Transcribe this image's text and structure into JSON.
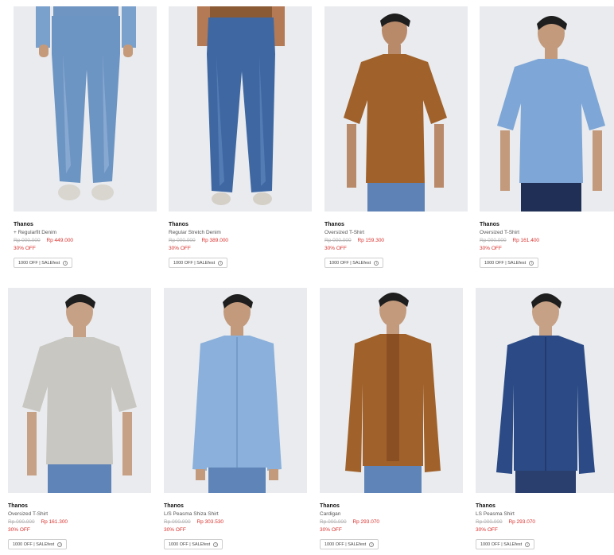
{
  "products": [
    {
      "brand": "Thanos",
      "name": "+ Regularfit Denim",
      "original_price": "Rp 000.000",
      "sale_price": "Rp 449.000",
      "discount": "30% OFF",
      "promo": "1000 OFF | SALEfest"
    },
    {
      "brand": "Thanos",
      "name": "Regular Stretch Denim",
      "original_price": "Rp 000.000",
      "sale_price": "Rp 389.000",
      "discount": "30% OFF",
      "promo": "1000 OFF | SALEfest"
    },
    {
      "brand": "Thanos",
      "name": "Oversized T-Shirt",
      "original_price": "Rp 000.000",
      "sale_price": "Rp 159.300",
      "discount": "30% OFF",
      "promo": "1000 OFF | SALEfest"
    },
    {
      "brand": "Thanos",
      "name": "Oversized T-Shirt",
      "original_price": "Rp 000.000",
      "sale_price": "Rp 161.400",
      "discount": "30% OFF",
      "promo": "1000 OFF | SALEfest"
    },
    {
      "brand": "Thanos",
      "name": "Oversized T-Shirt",
      "original_price": "Rp 000.000",
      "sale_price": "Rp 161.300",
      "discount": "30% OFF",
      "promo": "1000 OFF | SALEfest"
    },
    {
      "brand": "Thanos",
      "name": "L/S Peasma Shiza Shirt",
      "original_price": "Rp 000.000",
      "sale_price": "Rp 303.530",
      "discount": "30% OFF",
      "promo": "1000 OFF | SALEfest"
    },
    {
      "brand": "Thanos",
      "name": "Cardigan",
      "original_price": "Rp 000.000",
      "sale_price": "Rp 293.070",
      "discount": "30% OFF",
      "promo": "1000 OFF | SALEfest"
    },
    {
      "brand": "Thanos",
      "name": "LS Peasma Shirt",
      "original_price": "Rp 000.000",
      "sale_price": "Rp 293.070",
      "discount": "30% OFF",
      "promo": "1000 OFF | SALEfest"
    }
  ],
  "colors": {
    "sale": "#d8322e",
    "photo_bg": "#e9ebee",
    "denim_light": "#6d95c4",
    "denim_mid": "#3f68a3",
    "brown": "#a0612a",
    "sky_blue": "#7ea6d6",
    "grey_tee": "#c9c7c1",
    "chambray": "#8ab0db",
    "dark_denim": "#2c4b86"
  },
  "icons": {
    "promo_info": "info-circle-icon"
  }
}
